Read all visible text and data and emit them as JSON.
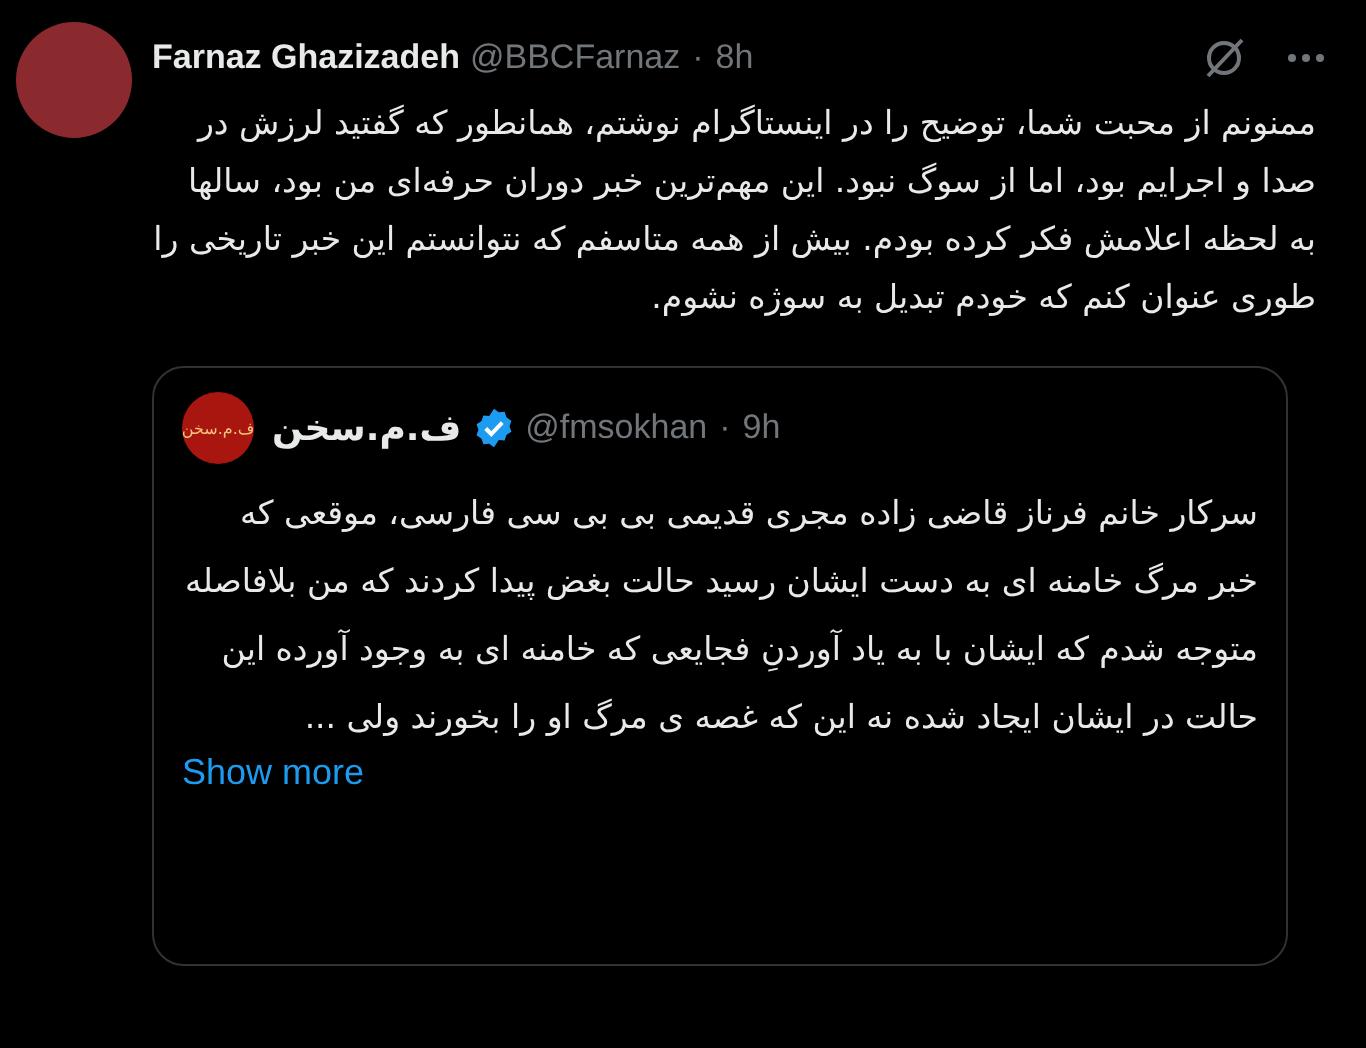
{
  "tweet": {
    "author": {
      "name": "Farnaz Ghazizadeh",
      "handle": "@BBCFarnaz",
      "time": "8h",
      "separator": "·"
    },
    "text": "ممنونم از محبت شما، توضیح را در اینستاگرام نوشتم، همانطور که گفتید لرزش در صدا و اجرایم بود، اما از سوگ نبود. این مهم‌ترین خبر دوران حرفه‌ای من بود، سالها به لحظه اعلامش فکر کرده بودم. بیش از همه متاسفم که نتوانستم  این خبر تاریخی را طوری عنوان کنم که خودم تبدیل به سوژه نشوم.",
    "quote": {
      "avatar_text": "ف.م.سخن",
      "name": "ف.م.سخن",
      "verified": true,
      "handle": "@fmsokhan",
      "time": "9h",
      "separator": "·",
      "text": "سرکار خانم فرناز قاضی زاده مجری قدیمی بی بی سی فارسی، موقعی که خبر مرگ خامنه ای به دست ایشان رسید حالت بغض پیدا کردند که من بلافاصله متوجه شدم که ایشان با به یاد آوردنِ فجایعی که خامنه ای به وجود آورده این حالت در ایشان ایجاد شده نه این که غصه ی مرگ او را بخورند ولی ...",
      "show_more": "Show more"
    }
  }
}
